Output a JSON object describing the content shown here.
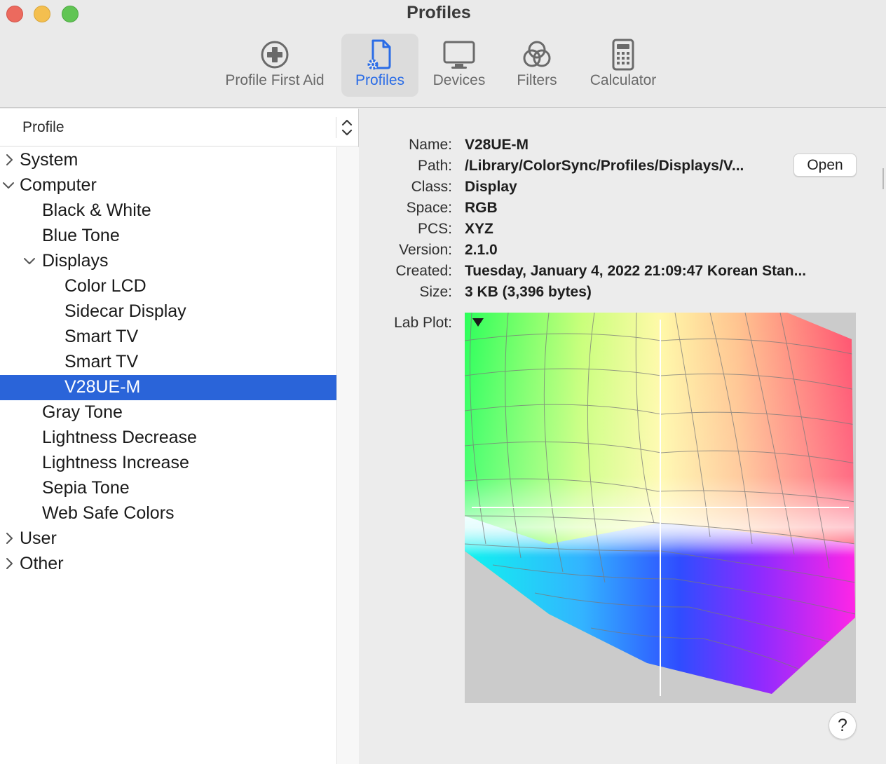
{
  "window": {
    "title": "Profiles"
  },
  "toolbar": {
    "items": [
      {
        "label": "Profile First Aid",
        "icon": "first-aid-icon"
      },
      {
        "label": "Profiles",
        "icon": "profiles-document-icon",
        "active": true
      },
      {
        "label": "Devices",
        "icon": "display-icon"
      },
      {
        "label": "Filters",
        "icon": "filters-circles-icon"
      },
      {
        "label": "Calculator",
        "icon": "calculator-icon"
      }
    ]
  },
  "sidebar": {
    "header": "Profile",
    "rows": [
      {
        "label": "System",
        "chevron": "right"
      },
      {
        "label": "Computer",
        "chevron": "down"
      },
      {
        "label": "Black & White"
      },
      {
        "label": "Blue Tone"
      },
      {
        "label": "Displays",
        "chevron": "down"
      },
      {
        "label": "Color LCD"
      },
      {
        "label": "Sidecar Display"
      },
      {
        "label": "Smart TV"
      },
      {
        "label": "Smart TV"
      },
      {
        "label": "V28UE-M",
        "selected": true
      },
      {
        "label": "Gray Tone"
      },
      {
        "label": "Lightness Decrease"
      },
      {
        "label": "Lightness Increase"
      },
      {
        "label": "Sepia Tone"
      },
      {
        "label": "Web Safe Colors"
      },
      {
        "label": "User",
        "chevron": "right"
      },
      {
        "label": "Other",
        "chevron": "right"
      }
    ]
  },
  "details": {
    "fields": [
      {
        "label": "Name:",
        "value": "V28UE-M"
      },
      {
        "label": "Path:",
        "value": "/Library/ColorSync/Profiles/Displays/V..."
      },
      {
        "label": "Class:",
        "value": "Display"
      },
      {
        "label": "Space:",
        "value": "RGB"
      },
      {
        "label": "PCS:",
        "value": "XYZ"
      },
      {
        "label": "Version:",
        "value": "2.1.0"
      },
      {
        "label": "Created:",
        "value": "Tuesday, January 4, 2022 21:09:47 Korean Stan..."
      },
      {
        "label": "Size:",
        "value": "3 KB (3,396 bytes)"
      }
    ],
    "open_label": "Open",
    "lab_plot_label": "Lab Plot:",
    "help_label": "?"
  },
  "colors": {
    "accent": "#2a6ce6",
    "selection": "#2a64d9",
    "plot_background": "#cbcbcb"
  }
}
